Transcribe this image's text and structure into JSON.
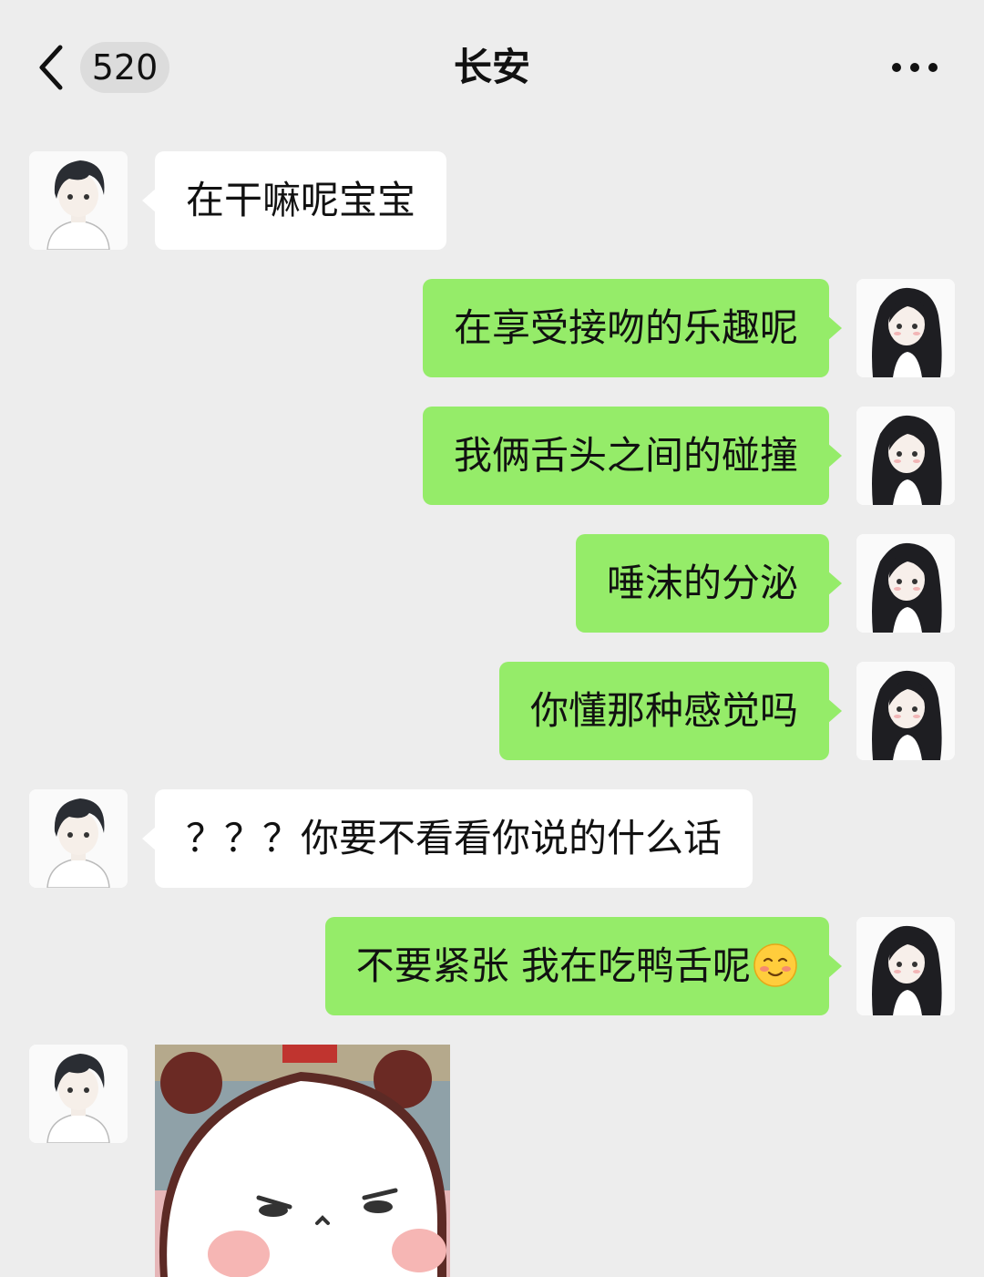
{
  "header": {
    "back_icon": "chevron-left-icon",
    "unread_count": "520",
    "title": "长安",
    "more_icon": "more-dots-icon"
  },
  "messages": [
    {
      "from": "them",
      "text": "在干嘛呢宝宝"
    },
    {
      "from": "me",
      "text": "在享受接吻的乐趣呢"
    },
    {
      "from": "me",
      "text": "我俩舌头之间的碰撞"
    },
    {
      "from": "me",
      "text": "唾沫的分泌"
    },
    {
      "from": "me",
      "text": "你懂那种感觉吗"
    },
    {
      "from": "them",
      "text": "？？？你要不看看你说的什么话"
    },
    {
      "from": "me",
      "text": "不要紧张 我在吃鸭舌呢",
      "emoji": "smiling-blush-emoji"
    },
    {
      "from": "them",
      "sticker": "panda-sticker"
    }
  ],
  "colors": {
    "background": "#ededed",
    "outgoing_bubble": "#95ec69",
    "incoming_bubble": "#ffffff"
  }
}
